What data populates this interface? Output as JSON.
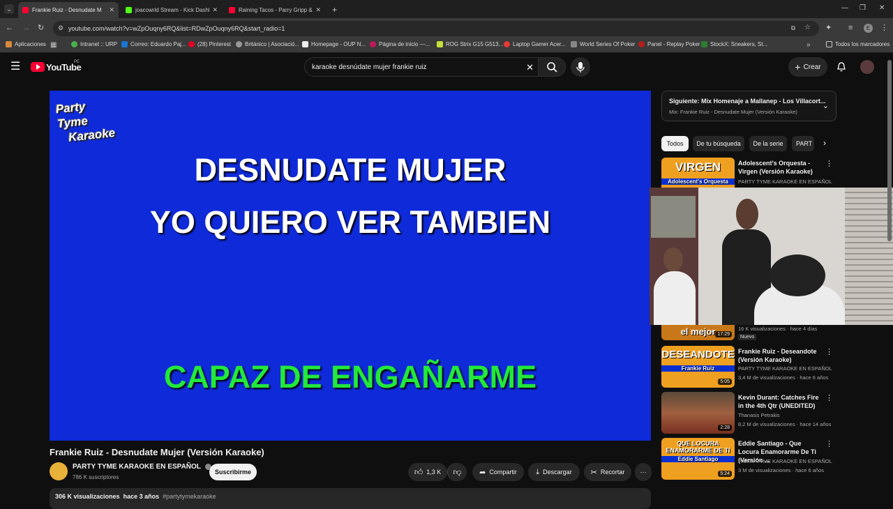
{
  "browser": {
    "tabs": [
      {
        "label": "Frankie Ruiz - Desnudate M",
        "color": "#ff0033",
        "active": true
      },
      {
        "label": "joacowrld Stream - Kick Dashbo",
        "color": "#53fc18",
        "active": false
      },
      {
        "label": "Raining Tacos - Parry Gripp & B",
        "color": "#ff0033",
        "active": false
      }
    ],
    "url": "youtube.com/watch?v=wZpOuqny6RQ&list=RDwZpOuqny6RQ&start_radio=1",
    "bookmarks": [
      "Aplicaciones",
      "Intranet :: URP",
      "Correo: Eduardo Paj...",
      "(28) Pinterest",
      "Británico | Asociació...",
      "Homepage - OUP N...",
      "Página de inicio —...",
      "ROG Strix G15 G513...",
      "Laptop Gamer Acer...",
      "World Series Of Poker",
      "Panel - Replay Poker",
      "StockX: Sneakers, St..."
    ],
    "all_bookmarks": "Todos los marcadores"
  },
  "header": {
    "logo_text": "YouTube",
    "region": "PE",
    "search_value": "karaoke desnúdate mujer frankie ruiz",
    "create_label": "Crear"
  },
  "player": {
    "logo_line1": "Party Tyme",
    "logo_line2": "Karaoke",
    "line1": "DESNUDATE MUJER",
    "line2": "YO QUIERO VER TAMBIEN",
    "line3": "CAPAZ DE ENGAÑARME"
  },
  "video": {
    "title": "Frankie Ruiz - Desnudate Mujer (Versión Karaoke)",
    "channel": "PARTY TYME KARAOKE EN ESPAÑOL",
    "subscribers": "786 K suscriptores",
    "subscribe_label": "Suscribirme",
    "likes": "1,3 K",
    "share_label": "Compartir",
    "download_label": "Descargar",
    "clip_label": "Recortar",
    "views": "306 K visualizaciones",
    "date": "hace 3 años",
    "hashtag": "#partytymekaraoke"
  },
  "sidebar": {
    "upnext_title": "Siguiente: Mix Homenaje a Mallanep - Los Villacort...",
    "upnext_sub": "Mix: Frankie Ruiz - Desnudate Mujer (Versión Karaoke)",
    "chips": [
      "Todos",
      "De tu búsqueda",
      "De la serie",
      "PART"
    ],
    "items": [
      {
        "thumb_text": "VIRGEN",
        "thumb_sub": "Adolescent's Orquesta",
        "title": "Adolescent's Orquesta - Virgen (Versión Karaoke)",
        "channel": "PARTY TYME KARAOKE EN ESPAÑOL",
        "meta": ""
      },
      {
        "thumb_text": "el mejor",
        "thumb_sub": "",
        "duration": "17:29",
        "title": "",
        "channel": "",
        "meta": "16 K visualizaciones · hace 4 días",
        "badge": "Nuevo"
      },
      {
        "thumb_text": "DESEANDOTE",
        "thumb_sub": "Frankie Ruiz",
        "duration": "5:05",
        "title": "Frankie Ruiz - Deseandote (Versión Karaoke)",
        "channel": "PARTY TYME KARAOKE EN ESPAÑOL",
        "meta": "3,4 M de visualizaciones · hace 6 años"
      },
      {
        "thumb_text": "",
        "thumb_sub": "",
        "duration": "2:28",
        "title": "Kevin Durant: Catches Fire in the 4th Qtr (UNEDITED)",
        "channel": "Thanasis Petrakis",
        "meta": "8,2 M de visualizaciones · hace 14 años"
      },
      {
        "thumb_text": "QUE LOCURA ENAMORARME DE TI",
        "thumb_sub": "Eddie Santiago",
        "duration": "5:24",
        "title": "Eddie Santiago - Que Locura Enamorarme De Ti (Versión ...",
        "channel": "PARTY TYME KARAOKE EN ESPAÑOL",
        "meta": "3 M de visualizaciones · hace 6 años"
      }
    ]
  },
  "colors": {
    "accent": "#ff0033",
    "player_bg": "#0f2ad8",
    "lyric_highlight": "#22e83c"
  }
}
